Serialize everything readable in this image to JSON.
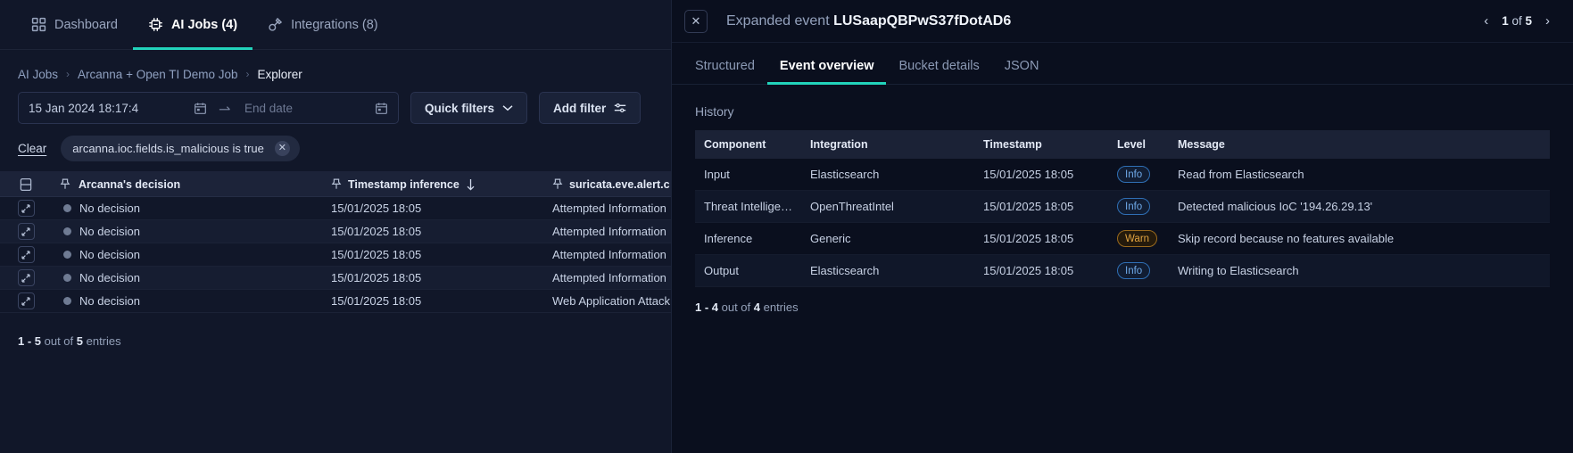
{
  "nav": {
    "items": [
      {
        "label": "Dashboard",
        "icon": "grid-icon",
        "active": false
      },
      {
        "label": "AI Jobs (4)",
        "icon": "chip-icon",
        "active": true
      },
      {
        "label": "Integrations (8)",
        "icon": "plug-icon",
        "active": false
      }
    ]
  },
  "breadcrumb": {
    "items": [
      "AI Jobs",
      "Arcanna + Open TI Demo Job",
      "Explorer"
    ],
    "separator": "›"
  },
  "filterbar": {
    "start_date_value": "15 Jan 2024 18:17:4",
    "end_date_placeholder": "End date",
    "range_arrow": "→",
    "quick_filters_label": "Quick filters",
    "add_filter_label": "Add filter"
  },
  "chips": {
    "clear_label": "Clear",
    "items": [
      {
        "label": "arcanna.ioc.fields.is_malicious is true",
        "close": "✕"
      }
    ]
  },
  "table": {
    "columns": [
      {
        "label": "Arcanna's decision",
        "pinned": true,
        "sorted": false
      },
      {
        "label": "Timestamp inference",
        "pinned": true,
        "sorted": true
      },
      {
        "label": "suricata.eve.alert.c",
        "pinned": true,
        "sorted": false
      }
    ],
    "rows": [
      {
        "decision": "No decision",
        "timestamp": "15/01/2025 18:05",
        "suricata": "Attempted Information"
      },
      {
        "decision": "No decision",
        "timestamp": "15/01/2025 18:05",
        "suricata": "Attempted Information"
      },
      {
        "decision": "No decision",
        "timestamp": "15/01/2025 18:05",
        "suricata": "Attempted Information"
      },
      {
        "decision": "No decision",
        "timestamp": "15/01/2025 18:05",
        "suricata": "Attempted Information"
      },
      {
        "decision": "No decision",
        "timestamp": "15/01/2025 18:05",
        "suricata": "Web Application Attack"
      }
    ],
    "pager_range": "1 - 5",
    "pager_middle": " out of ",
    "pager_total": "5",
    "pager_suffix": " entries"
  },
  "panel": {
    "close_icon": "✕",
    "title_prefix": "Expanded event ",
    "event_id": "LUSaapQBPwS37fDotAD6",
    "prev_icon": "‹",
    "next_icon": "›",
    "position_current": "1",
    "position_word": " of ",
    "position_total": "5",
    "tabs": [
      {
        "label": "Structured",
        "active": false
      },
      {
        "label": "Event overview",
        "active": true
      },
      {
        "label": "Bucket details",
        "active": false
      },
      {
        "label": "JSON",
        "active": false
      }
    ],
    "history_label": "History",
    "history_columns": [
      "Component",
      "Integration",
      "Timestamp",
      "Level",
      "Message"
    ],
    "history_rows": [
      {
        "component": "Input",
        "integration": "Elasticsearch",
        "timestamp": "15/01/2025 18:05",
        "level": "Info",
        "level_kind": "info",
        "message": "Read from Elasticsearch"
      },
      {
        "component": "Threat Intellige…",
        "integration": "OpenThreatIntel",
        "timestamp": "15/01/2025 18:05",
        "level": "Info",
        "level_kind": "info",
        "message": "Detected malicious IoC '194.26.29.13'"
      },
      {
        "component": "Inference",
        "integration": "Generic",
        "timestamp": "15/01/2025 18:05",
        "level": "Warn",
        "level_kind": "warn",
        "message": "Skip record because no features available"
      },
      {
        "component": "Output",
        "integration": "Elasticsearch",
        "timestamp": "15/01/2025 18:05",
        "level": "Info",
        "level_kind": "info",
        "message": "Writing to Elasticsearch"
      }
    ],
    "pager_range": "1 - 4",
    "pager_middle": " out of ",
    "pager_total": "4",
    "pager_suffix": " entries"
  },
  "colors": {
    "accent": "#22d3bb",
    "info": "#6fa9e8",
    "warn": "#e0a341",
    "bg_left": "#111729",
    "bg_right": "#0a0f1e"
  }
}
